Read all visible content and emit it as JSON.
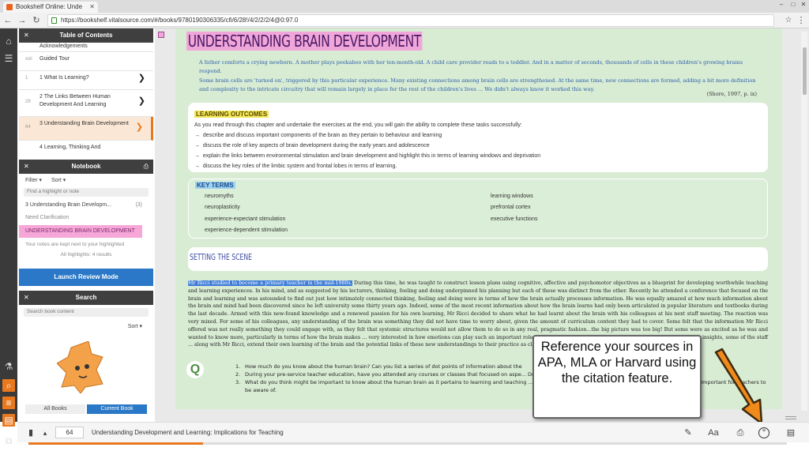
{
  "browser": {
    "tab_title": "Bookshelf Online: Unde",
    "url": "https://bookshelf.vitalsource.com/#/books/9780190306335/cfi/6/28!/4/2/2/2/4@0:97.0"
  },
  "toc": {
    "title": "Table of Contents",
    "items": [
      {
        "num": "",
        "label": "Acknowledgements"
      },
      {
        "num": "xvii",
        "label": "Guided Tour"
      },
      {
        "num": "1",
        "label": "1 What Is Learning?"
      },
      {
        "num": "29",
        "label": "2 The Links Between Human Development And Learning"
      },
      {
        "num": "64",
        "label": "3 Understanding Brain Development"
      },
      {
        "num": "",
        "label": "4 Learning, Thinking And"
      }
    ]
  },
  "notebook": {
    "title": "Notebook",
    "filter_label": "Filter",
    "sort_label": "Sort",
    "search_placeholder": "Find a highlight or note",
    "chapter_label": "3 Understanding Brain Developm...",
    "chapter_count": "(3)",
    "tag_label": "Need Clarification",
    "highlight_text": "UNDERSTANDING BRAIN DEVELOPMENT",
    "note_text": "Your notes are kept next to your highlighted",
    "all_highlights": "All highlights: 4 results",
    "launch_button": "Launch Review Mode"
  },
  "search": {
    "title": "Search",
    "placeholder": "Search book content",
    "sort_label": "Sort",
    "tab_all": "All Books",
    "tab_current": "Current Book"
  },
  "content": {
    "title": "UNDERSTANDING BRAIN DEVELOPMENT",
    "intro_p1": "A father comforts a crying newborn. A mother plays peekaboo with her ten-month-old. A child care provider reads to a toddler. And in a matter of seconds, thousands of cells in these children's growing brains respond.",
    "intro_p2": "Some brain cells are 'turned on', triggered by this particular experience. Many existing connections among brain cells are strengthened. At the same time, new connections are formed, adding a bit more definition and complexity to the intricate circuitry that will remain largely in place for the rest of the children's lives ... We didn't always know it worked this way.",
    "citation": "(Shore, 1997, p. ix)",
    "lo_title": "LEARNING OUTCOMES",
    "lo_intro": "As you read through this chapter and undertake the exercises at the end, you will gain the ability to complete these tasks successfully:",
    "outcomes": [
      "describe and discuss important components of the brain as they pertain to behaviour and learning",
      "discuss the role of key aspects of brain development during the early years and adolescence",
      "explain the links between environmental stimulation and brain development and highlight this in terms of learning windows and deprivation",
      "discuss the key roles of the limbic system and frontal lobes in terms of learning."
    ],
    "kt_title": "KEY TERMS",
    "key_terms_left": [
      "neuromyths",
      "neuroplasticity",
      "experience-expectant stimulation",
      "experience-dependent stimulation"
    ],
    "key_terms_right": [
      "learning windows",
      "prefrontal cortex",
      "executive functions"
    ],
    "setting_title": "SETTING THE SCENE",
    "para_highlight": "Mr Ricci studied to become a primary teacher in the mid-1980s.",
    "para_rest": "During this time, he was taught to construct lesson plans using cognitive, affective and psychomotor objectives as a blueprint for developing worthwhile teaching and learning experiences. In his mind, and as suggested by his lecturers, thinking, feeling and doing underpinned his planning but each of these was distinct from the other. Recently he attended a conference that focused on the brain and learning and was astounded to find out just how intimately connected thinking, feeling and doing were in terms of how the brain actually processes information. He was equally amazed at how much information about the brain and mind had been discovered since he left university some thirty years ago. Indeed, some of the most recent information about how the brain learns had only been articulated in popular literature and textbooks during the last decade. Armed with this new-found knowledge and a renewed passion for his own learning, Mr Ricci decided to share what he had learnt about the brain with his colleagues at his next staff meeting. The reaction was very mixed. For some of his colleagues, any understanding of the brain was something they did not have time to worry about, given the amount of curriculum content they had to cover. Some felt that the information Mr Ricci offered was not really something they could engage with, as they felt that systemic structures would not allow them to do so in any real, pragmatic fashion...the big picture was too big! But some were as excited as he was and wanted to know more, particularly in terms of how the brain makes ... very interested in how emotions can play such an important role in learning and in so many different ways. Armed with these new insights, some of the staff ... along with Mr Ricci, extend their own learning of the brain and the potential links of these new understandings to their practice as classroom teachers.",
    "questions": [
      "How much do you know about the human brain? Can you list a series of dot points of information about the",
      "During your pre-service teacher education, have you attended any courses or classes that focused on aspe... Do you think this is important? Why or why not?",
      "What do you think might be important to know about the human brain as it pertains to learning and teaching ... between development, learning and teaching that you think are important for teachers to be aware of."
    ]
  },
  "callout": {
    "text": "Reference your sources in APA, MLA or Harvard using the citation feature."
  },
  "bottombar": {
    "page": "64",
    "book_title": "Understanding Development and Learning: Implications for Teaching",
    "progress": 0.23
  },
  "colors": {
    "accent_orange": "#e9781e",
    "page_green": "#d8ecd4",
    "highlight_pink": "#f6a7d8",
    "lo_yellow": "#f3e85a",
    "kt_blue": "#9fd1f0",
    "launch_blue": "#2a78c7"
  }
}
